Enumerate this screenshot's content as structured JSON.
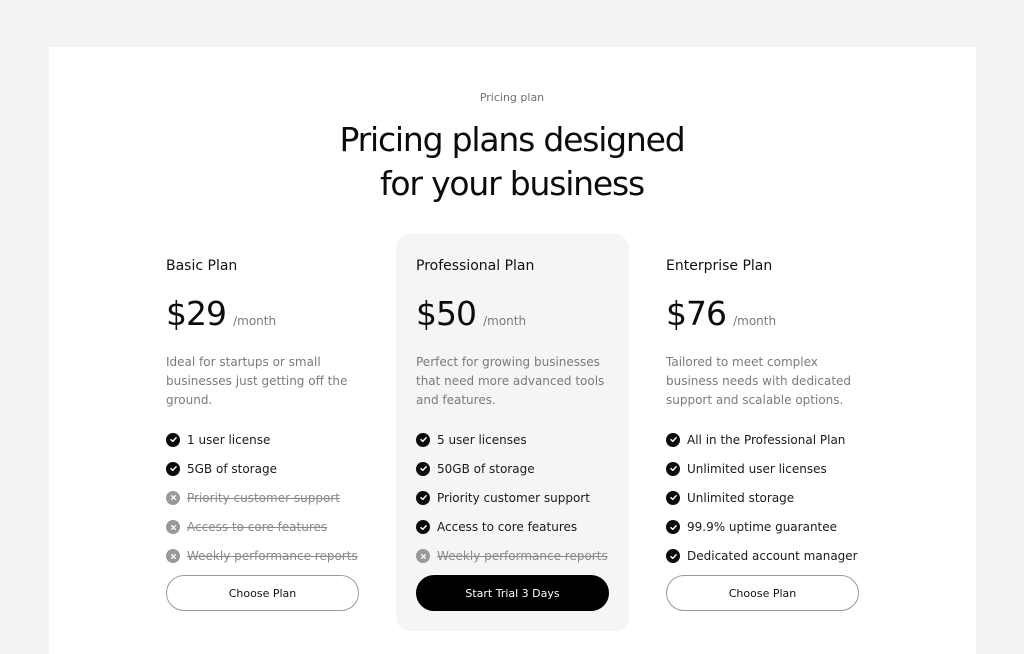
{
  "header": {
    "eyebrow": "Pricing plan",
    "headline_line1": "Pricing plans designed",
    "headline_line2": "for your business"
  },
  "plans": [
    {
      "name": "Basic Plan",
      "price": "$29",
      "period": "/month",
      "description": "Ideal for startups or small businesses just getting off the ground.",
      "features": [
        {
          "label": "1 user license",
          "included": true,
          "icon": "check-circle-icon"
        },
        {
          "label": "5GB of storage",
          "included": true,
          "icon": "check-circle-icon"
        },
        {
          "label": "Priority customer support",
          "included": false,
          "icon": "x-circle-icon"
        },
        {
          "label": "Access to core features",
          "included": false,
          "icon": "x-circle-icon"
        },
        {
          "label": "Weekly performance reports",
          "included": false,
          "icon": "x-circle-icon"
        }
      ],
      "button_label": "Choose Plan"
    },
    {
      "name": "Professional Plan",
      "price": "$50",
      "period": "/month",
      "description": "Perfect for growing businesses that need more advanced tools and features.",
      "features": [
        {
          "label": "5 user licenses",
          "included": true,
          "icon": "check-circle-icon"
        },
        {
          "label": "50GB of storage",
          "included": true,
          "icon": "check-circle-icon"
        },
        {
          "label": "Priority customer support",
          "included": true,
          "icon": "check-circle-icon"
        },
        {
          "label": "Access to core features",
          "included": true,
          "icon": "check-circle-icon"
        },
        {
          "label": "Weekly performance reports",
          "included": false,
          "icon": "x-circle-icon"
        }
      ],
      "button_label": "Start Trial 3 Days"
    },
    {
      "name": "Enterprise Plan",
      "price": "$76",
      "period": "/month",
      "description": "Tailored to meet complex business needs with dedicated support and scalable options.",
      "features": [
        {
          "label": "All in the Professional Plan",
          "included": true,
          "icon": "check-circle-icon"
        },
        {
          "label": "Unlimited user licenses",
          "included": true,
          "icon": "check-circle-icon"
        },
        {
          "label": "Unlimited storage",
          "included": true,
          "icon": "check-circle-icon"
        },
        {
          "label": "99.9% uptime guarantee",
          "included": true,
          "icon": "check-circle-icon"
        },
        {
          "label": "Dedicated account manager",
          "included": true,
          "icon": "check-circle-icon"
        }
      ],
      "button_label": "Choose Plan"
    }
  ],
  "colors": {
    "page_background": "#f3f3f3",
    "panel_background": "#ffffff",
    "featured_card": "#f5f5f5",
    "primary": "#000000",
    "muted_text": "#7b7b7b"
  }
}
